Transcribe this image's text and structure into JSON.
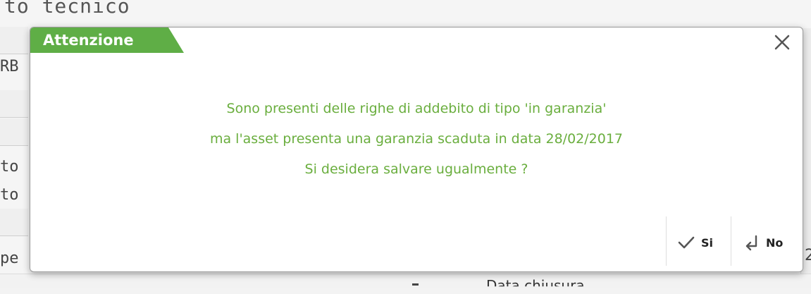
{
  "background": {
    "window_title": "to tecnico",
    "left_fragments": [
      "RB",
      "to",
      "to",
      "pe"
    ],
    "bottom_label": "Data chiusura",
    "right_fragment": "2"
  },
  "dialog": {
    "title": "Attenzione",
    "close_icon": "close-icon",
    "accent_color": "#5fae46",
    "message_color": "#6aae3e",
    "message_lines": [
      "Sono presenti delle righe di addebito di tipo 'in garanzia'",
      "ma l'asset presenta una garanzia scaduta in data 28/02/2017",
      "Si desidera salvare ugualmente ?"
    ],
    "buttons": {
      "yes": {
        "label": "Si",
        "icon": "checkmark-icon"
      },
      "no": {
        "label": "No",
        "icon": "return-arrow-icon"
      }
    }
  }
}
